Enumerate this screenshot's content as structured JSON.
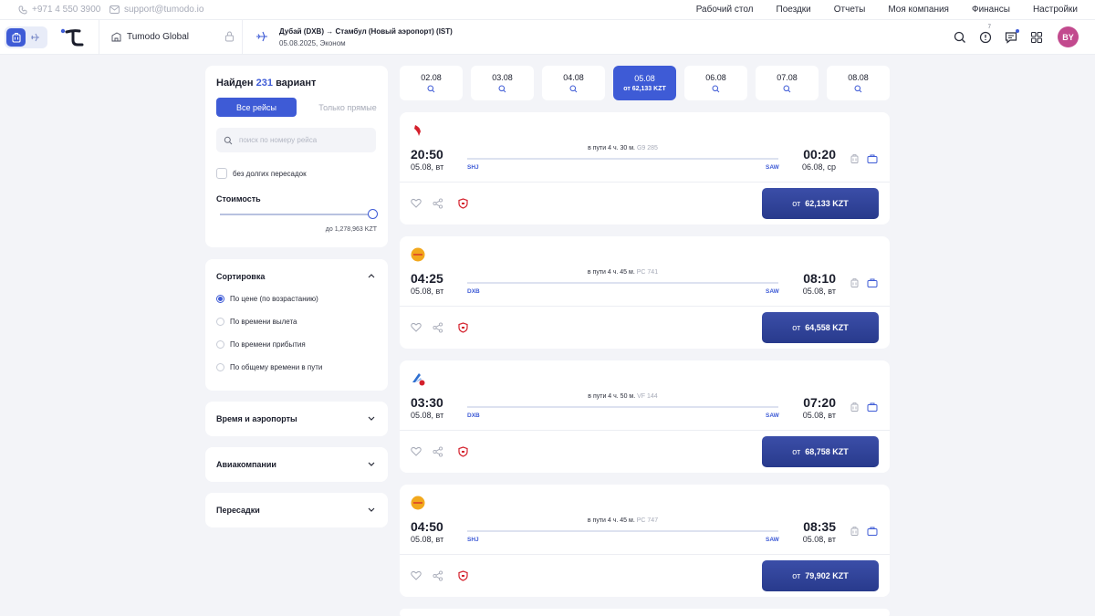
{
  "topbar": {
    "phone": "+971 4 550 3900",
    "email": "support@tumodo.io",
    "nav": [
      "Рабочий стол",
      "Поездки",
      "Отчеты",
      "Моя компания",
      "Финансы",
      "Настройки"
    ]
  },
  "header": {
    "company": "Tumodo Global",
    "route_title": "Дубай (DXB) → Стамбул (Новый аэропорт) (IST)",
    "route_sub": "05.08.2025, Эконом",
    "notifications_count": "7",
    "avatar": "BY"
  },
  "sidebar": {
    "found_prefix": "Найден",
    "found_count": "231",
    "found_suffix": "вариант",
    "filter_all": "Все рейсы",
    "filter_direct": "Только прямые",
    "search_placeholder": "поиск по номеру рейса",
    "no_long_transfers": "без долгих пересадок",
    "cost_title": "Стоимость",
    "cost_max": "до 1,278,963 KZT",
    "sort_title": "Сортировка",
    "sort_options": [
      "По цене (по возрастанию)",
      "По времени вылета",
      "По времени прибытия",
      "По общему времени в пути"
    ],
    "sections": [
      "Время и аэропорты",
      "Авиакомпании",
      "Пересадки"
    ]
  },
  "dates": [
    {
      "label": "02.08",
      "price": ""
    },
    {
      "label": "03.08",
      "price": ""
    },
    {
      "label": "04.08",
      "price": ""
    },
    {
      "label": "05.08",
      "price": "от 62,133 KZT"
    },
    {
      "label": "06.08",
      "price": ""
    },
    {
      "label": "07.08",
      "price": ""
    },
    {
      "label": "08.08",
      "price": ""
    }
  ],
  "flights": [
    {
      "dep_time": "20:50",
      "dep_date": "05.08, вт",
      "arr_time": "00:20",
      "arr_date": "06.08, ср",
      "duration": "в пути 4 ч. 30 м.",
      "code": "G9 285",
      "from": "SHJ",
      "to": "SAW",
      "price_prefix": "от",
      "price": "62,133 KZT",
      "airline_color": "#d4202c"
    },
    {
      "dep_time": "04:25",
      "dep_date": "05.08, вт",
      "arr_time": "08:10",
      "arr_date": "05.08, вт",
      "duration": "в пути 4 ч. 45 м.",
      "code": "PC 741",
      "from": "DXB",
      "to": "SAW",
      "price_prefix": "от",
      "price": "64,558 KZT",
      "airline_color": "#f2a81d"
    },
    {
      "dep_time": "03:30",
      "dep_date": "05.08, вт",
      "arr_time": "07:20",
      "arr_date": "05.08, вт",
      "duration": "в пути 4 ч. 50 м.",
      "code": "VF 144",
      "from": "DXB",
      "to": "SAW",
      "price_prefix": "от",
      "price": "68,758 KZT",
      "airline_color": "#2f6fd0"
    },
    {
      "dep_time": "04:50",
      "dep_date": "05.08, вт",
      "arr_time": "08:35",
      "arr_date": "05.08, вт",
      "duration": "в пути 4 ч. 45 м.",
      "code": "PC 747",
      "from": "SHJ",
      "to": "SAW",
      "price_prefix": "от",
      "price": "79,902 KZT",
      "airline_color": "#f2a81d"
    }
  ],
  "colors": {
    "accent": "#3e5bd6",
    "price_button": "#2f428f",
    "avatar": "#c24a8e"
  }
}
